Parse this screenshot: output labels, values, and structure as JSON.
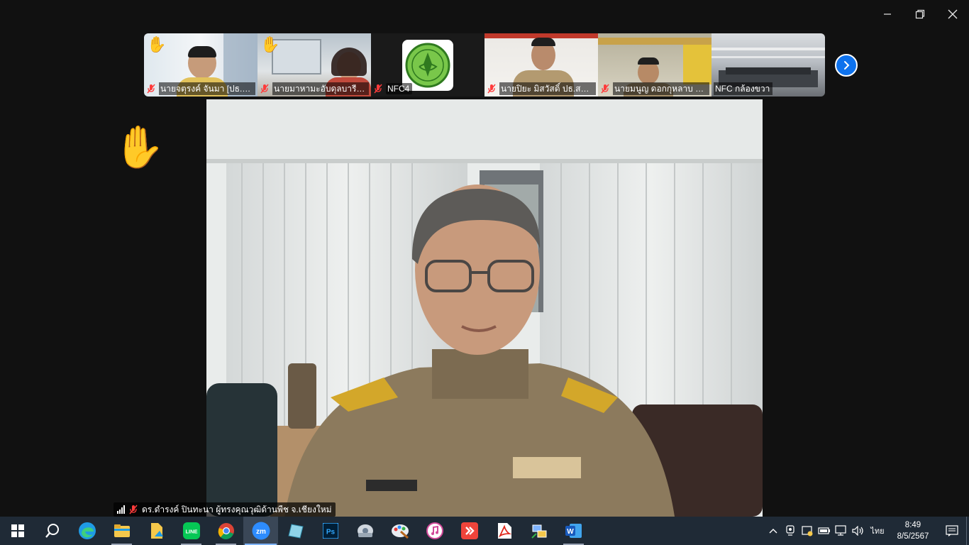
{
  "window": {
    "minimize_icon": "minimize-icon",
    "restore_icon": "restore-icon",
    "close_icon": "close-icon"
  },
  "gallery": {
    "tiles": [
      {
        "name": "นายจตุรงค์  จันมา [ปธ.ย์...",
        "hand_raised": true,
        "muted": true
      },
      {
        "name": "นายมาหามะอับดุลบารี  ยี...",
        "hand_raised": true,
        "muted": true
      },
      {
        "name": "NFC4",
        "hand_raised": false,
        "muted": true
      },
      {
        "name": "นายปิยะ มิสวัสดิ์ ปธ.สระบุรี",
        "hand_raised": false,
        "muted": true
      },
      {
        "name": "นายมนูญ ดอกกุหลาบ ปธ....",
        "hand_raised": false,
        "muted": true
      },
      {
        "name": "NFC กล้องขวา",
        "hand_raised": false,
        "muted": false
      }
    ],
    "next_icon": "chevron-right-icon"
  },
  "raise_hand_glyph": "✋",
  "speaker": {
    "name": "ดร.ดำรงค์ ปินทะนา ผู้ทรงคุณวุฒิด้านพืช จ.เชียงใหม่",
    "muted": true
  },
  "taskbar": {
    "apps": [
      {
        "id": "start",
        "icon": "windows-start-icon",
        "running": false,
        "active": false
      },
      {
        "id": "search",
        "icon": "search-icon",
        "running": false,
        "active": false
      },
      {
        "id": "edge",
        "icon": "edge-icon",
        "running": false,
        "active": false
      },
      {
        "id": "explorer",
        "icon": "file-explorer-icon",
        "running": true,
        "active": false
      },
      {
        "id": "files",
        "icon": "files-icon",
        "running": false,
        "active": false
      },
      {
        "id": "line",
        "icon": "line-icon",
        "running": true,
        "active": false
      },
      {
        "id": "chrome",
        "icon": "chrome-icon",
        "running": true,
        "active": false
      },
      {
        "id": "zoom",
        "icon": "zoom-icon",
        "running": true,
        "active": true
      },
      {
        "id": "note",
        "icon": "notepad-icon",
        "running": false,
        "active": false
      },
      {
        "id": "ps",
        "icon": "photoshop-icon",
        "running": false,
        "active": false
      },
      {
        "id": "disk",
        "icon": "disk-utility-icon",
        "running": false,
        "active": false
      },
      {
        "id": "paint",
        "icon": "paint-icon",
        "running": false,
        "active": false
      },
      {
        "id": "itunes",
        "icon": "itunes-icon",
        "running": false,
        "active": false
      },
      {
        "id": "anydesk",
        "icon": "anydesk-icon",
        "running": false,
        "active": false
      },
      {
        "id": "acrobat",
        "icon": "acrobat-icon",
        "running": false,
        "active": false
      },
      {
        "id": "network",
        "icon": "network-tool-icon",
        "running": false,
        "active": false
      },
      {
        "id": "word",
        "icon": "word-icon",
        "running": true,
        "active": false
      }
    ],
    "tray": {
      "lang": "ไทย",
      "time": "8:49",
      "date": "8/5/2567"
    }
  },
  "colors": {
    "zoom_blue": "#0e72ed",
    "taskbar_bg": "#1f2a36"
  }
}
